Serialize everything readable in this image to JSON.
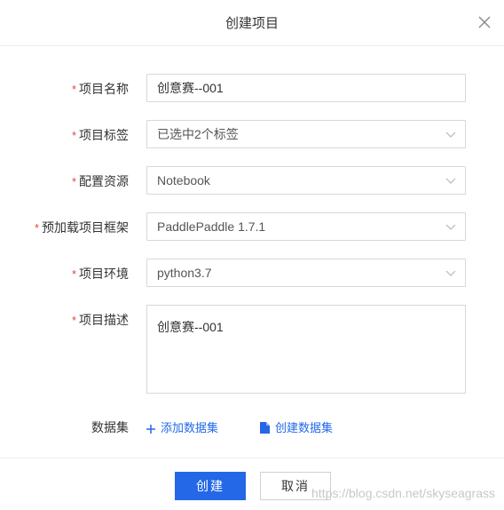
{
  "dialog": {
    "title": "创建项目",
    "close_icon": "close-icon"
  },
  "form": {
    "required_mark": "*",
    "project_name": {
      "label": "项目名称",
      "value": "创意赛--001"
    },
    "project_tags": {
      "label": "项目标签",
      "value": "已选中2个标签"
    },
    "resource": {
      "label": "配置资源",
      "value": "Notebook"
    },
    "framework": {
      "label": "预加载项目框架",
      "value": "PaddlePaddle 1.7.1"
    },
    "environment": {
      "label": "项目环境",
      "value": "python3.7"
    },
    "description": {
      "label": "项目描述",
      "value": "创意赛--001"
    },
    "dataset": {
      "label": "数据集",
      "add_link": "添加数据集",
      "create_link": "创建数据集",
      "add_icon": "plus-icon",
      "create_icon": "file-icon"
    }
  },
  "footer": {
    "create_button": "创建",
    "cancel_button": "取消"
  },
  "watermark": "https://blog.csdn.net/skyseagrass",
  "colors": {
    "primary": "#2468e8",
    "required": "#e5473c",
    "border": "#d8d8d8"
  }
}
